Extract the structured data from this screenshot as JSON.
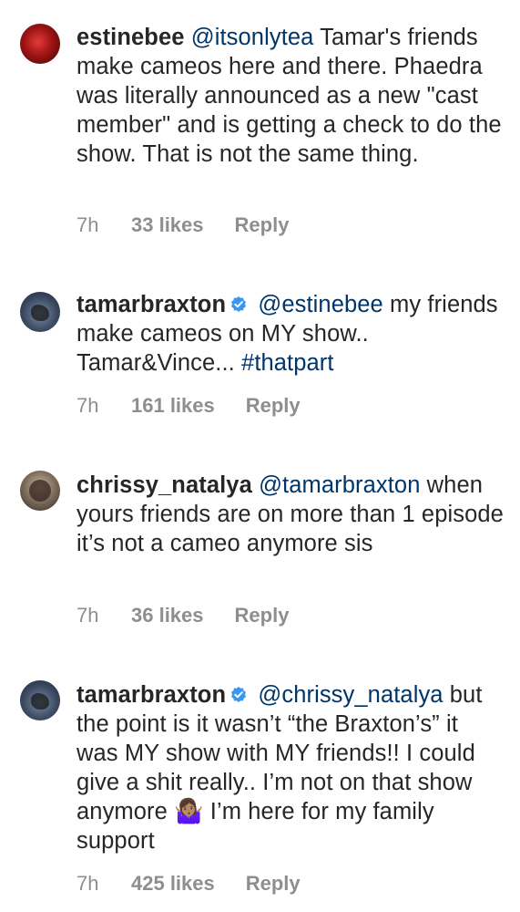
{
  "comments": [
    {
      "username": "estinebee",
      "verified": false,
      "mention": "@itsonlytea",
      "text": " Tamar's friends make cameos here and there. Phaedra was literally announced as a new \"cast member\" and is getting a check to do the show. That is not the same thing.",
      "time": "7h",
      "likes": "33 likes",
      "reply": "Reply"
    },
    {
      "username": "tamarbraxton",
      "verified": true,
      "mention": "@estinebee",
      "text": " my friends make cameos on MY show.. Tamar&Vince... ",
      "hashtag": "#thatpart",
      "time": "7h",
      "likes": "161 likes",
      "reply": "Reply"
    },
    {
      "username": "chrissy_natalya",
      "verified": false,
      "mention": "@tamarbraxton",
      "text": " when yours friends are on more than 1 episode it’s not a cameo anymore sis",
      "time": "7h",
      "likes": "36 likes",
      "reply": "Reply"
    },
    {
      "username": "tamarbraxton",
      "verified": true,
      "mention": "@chrissy_natalya",
      "text": " but the point is it wasn’t “the Braxton’s” it was MY show with MY friends!! I could give a shit really.. I’m not on that show anymore ",
      "emoji": "🤷🏽‍♀️",
      "text2": " I’m here for my family support",
      "time": "7h",
      "likes": "425 likes",
      "reply": "Reply"
    }
  ],
  "colors": {
    "text": "#262626",
    "link": "#003569",
    "meta": "#8e8e8e",
    "verified": "#3897f0"
  },
  "icons": {
    "verified": "verified-badge-icon",
    "shrug": "woman-shrugging-emoji"
  }
}
